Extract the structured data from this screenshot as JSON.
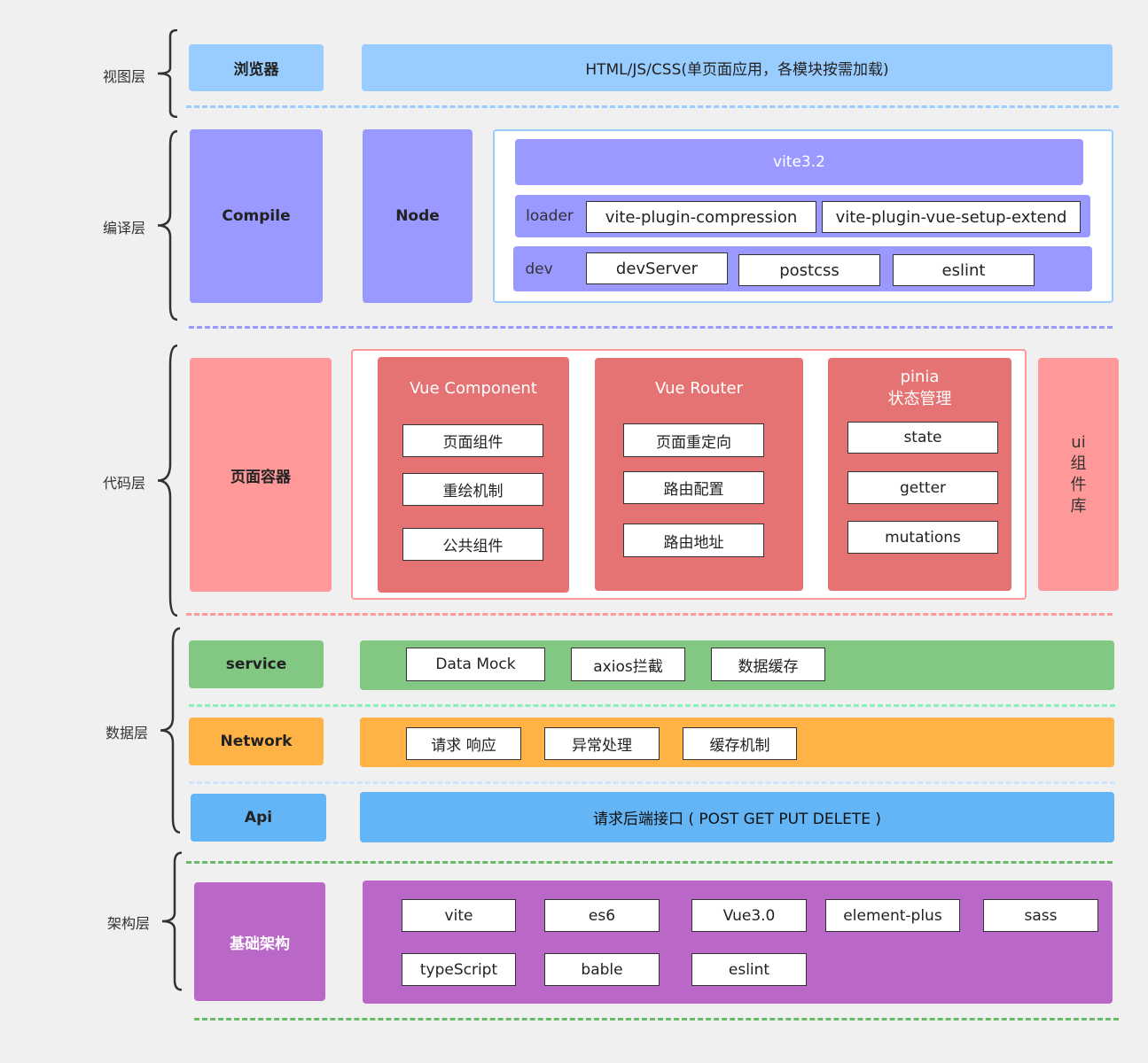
{
  "colors": {
    "view": "#99ccff",
    "compile": "#9999ff",
    "code_light": "#ff9999",
    "code": "#e57373",
    "service": "#82c882",
    "network": "#ffb347",
    "api": "#64b5f6",
    "arch": "#ba68c8"
  },
  "layers": {
    "view": {
      "label": "视图层",
      "head": "浏览器",
      "bar": "HTML/JS/CSS(单页面应用，各模块按需加载)"
    },
    "compile": {
      "label": "编译层",
      "compile": "Compile",
      "node": "Node",
      "vite": "vite3.2",
      "loader": "loader",
      "loader_items": [
        "vite-plugin-compression",
        "vite-plugin-vue-setup-extend"
      ],
      "dev": "dev",
      "dev_items": [
        "devServer",
        "postcss",
        "eslint"
      ]
    },
    "code": {
      "label": "代码层",
      "head": "页面容器",
      "vue_component": {
        "title": "Vue Component",
        "items": [
          "页面组件",
          "重绘机制",
          "公共组件"
        ]
      },
      "vue_router": {
        "title": "Vue Router",
        "items": [
          "页面重定向",
          "路由配置",
          "路由地址"
        ]
      },
      "pinia": {
        "title": "pinia",
        "subtitle": "状态管理",
        "items": [
          "state",
          "getter",
          "mutations"
        ]
      },
      "ui": [
        "ui",
        "组",
        "件",
        "库"
      ]
    },
    "data": {
      "label": "数据层",
      "service": {
        "head": "service",
        "items": [
          "Data Mock",
          "axios拦截",
          "数据缓存"
        ]
      },
      "network": {
        "head": "Network",
        "items": [
          "请求 响应",
          "异常处理",
          "缓存机制"
        ]
      },
      "api": {
        "head": "Api",
        "bar": "请求后端接口 ( POST GET PUT DELETE )"
      }
    },
    "arch": {
      "label": "架构层",
      "head": "基础架构",
      "items": [
        "vite",
        "es6",
        "Vue3.0",
        "element-plus",
        "sass",
        "typeScript",
        "bable",
        "eslint"
      ]
    }
  }
}
